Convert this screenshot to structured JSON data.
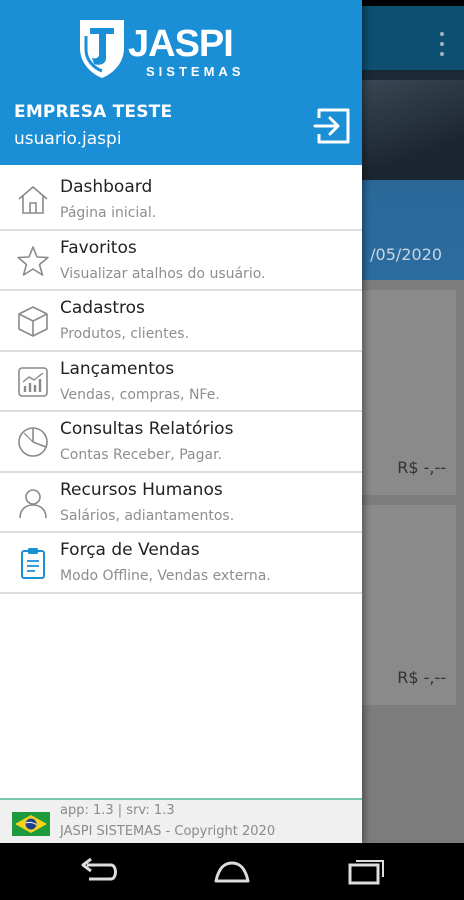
{
  "background": {
    "date_text": "/05/2020",
    "money_1": "R$ -,--",
    "money_2": "R$ -,--"
  },
  "header": {
    "logo_text": "JASPI",
    "logo_sub": "SISTEMAS",
    "company": "EMPRESA TESTE",
    "user": "usuario.jaspi",
    "logout_icon": "logout-icon"
  },
  "menu": {
    "items": [
      {
        "title": "Dashboard",
        "subtitle": "Página inicial.",
        "icon": "home-icon"
      },
      {
        "title": "Favoritos",
        "subtitle": "Visualizar atalhos do usuário.",
        "icon": "star-icon"
      },
      {
        "title": "Cadastros",
        "subtitle": "Produtos, clientes.",
        "icon": "box-icon"
      },
      {
        "title": "Lançamentos",
        "subtitle": "Vendas, compras, NFe.",
        "icon": "chart-icon"
      },
      {
        "title": "Consultas Relatórios",
        "subtitle": "Contas Receber, Pagar.",
        "icon": "pie-icon"
      },
      {
        "title": "Recursos Humanos",
        "subtitle": "Salários, adiantamentos.",
        "icon": "person-icon"
      },
      {
        "title": "Força de Vendas",
        "subtitle": "Modo Offline, Vendas externa.",
        "icon": "clipboard-icon"
      }
    ]
  },
  "footer": {
    "version": "app: 1.3 | srv: 1.3",
    "copyright": "JASPI SISTEMAS - Copyright 2020"
  },
  "colors": {
    "header_bg": "#1a8fd6",
    "toolbar_bg": "#0c4f71",
    "footer_accent": "#79c7a9"
  }
}
